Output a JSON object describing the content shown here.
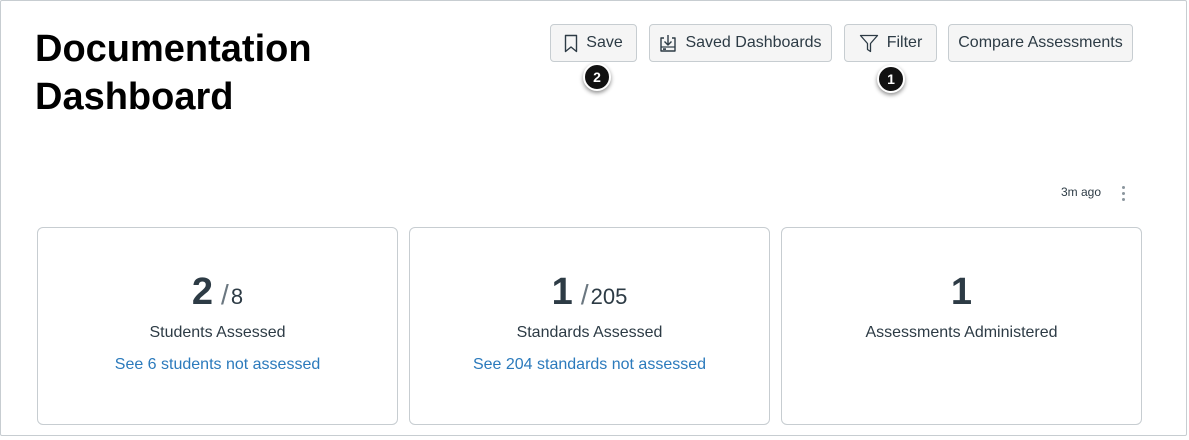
{
  "page": {
    "title": "Documentation Dashboard"
  },
  "toolbar": {
    "save_label": "Save",
    "saved_dashboards_label": "Saved Dashboards",
    "filter_label": "Filter",
    "compare_label": "Compare Assessments"
  },
  "callouts": {
    "save": "2",
    "filter": "1"
  },
  "status": {
    "updated": "3m ago"
  },
  "cards": [
    {
      "value": "2",
      "total": "8",
      "label": "Students Assessed",
      "link": "See 6 students not assessed"
    },
    {
      "value": "1",
      "total": "205",
      "label": "Standards Assessed",
      "link": "See 204 standards not assessed"
    },
    {
      "value": "1",
      "label": "Assessments Administered"
    }
  ],
  "icons": {
    "save": "bookmark-icon",
    "saved_dashboards": "download-box-icon",
    "filter": "filter-icon",
    "menu": "kebab-menu-icon"
  },
  "colors": {
    "link": "#2b7abc",
    "text": "#2d3b45",
    "callout": "#111111",
    "button_bg": "#f5f5f5",
    "border": "#c7cdd1"
  }
}
